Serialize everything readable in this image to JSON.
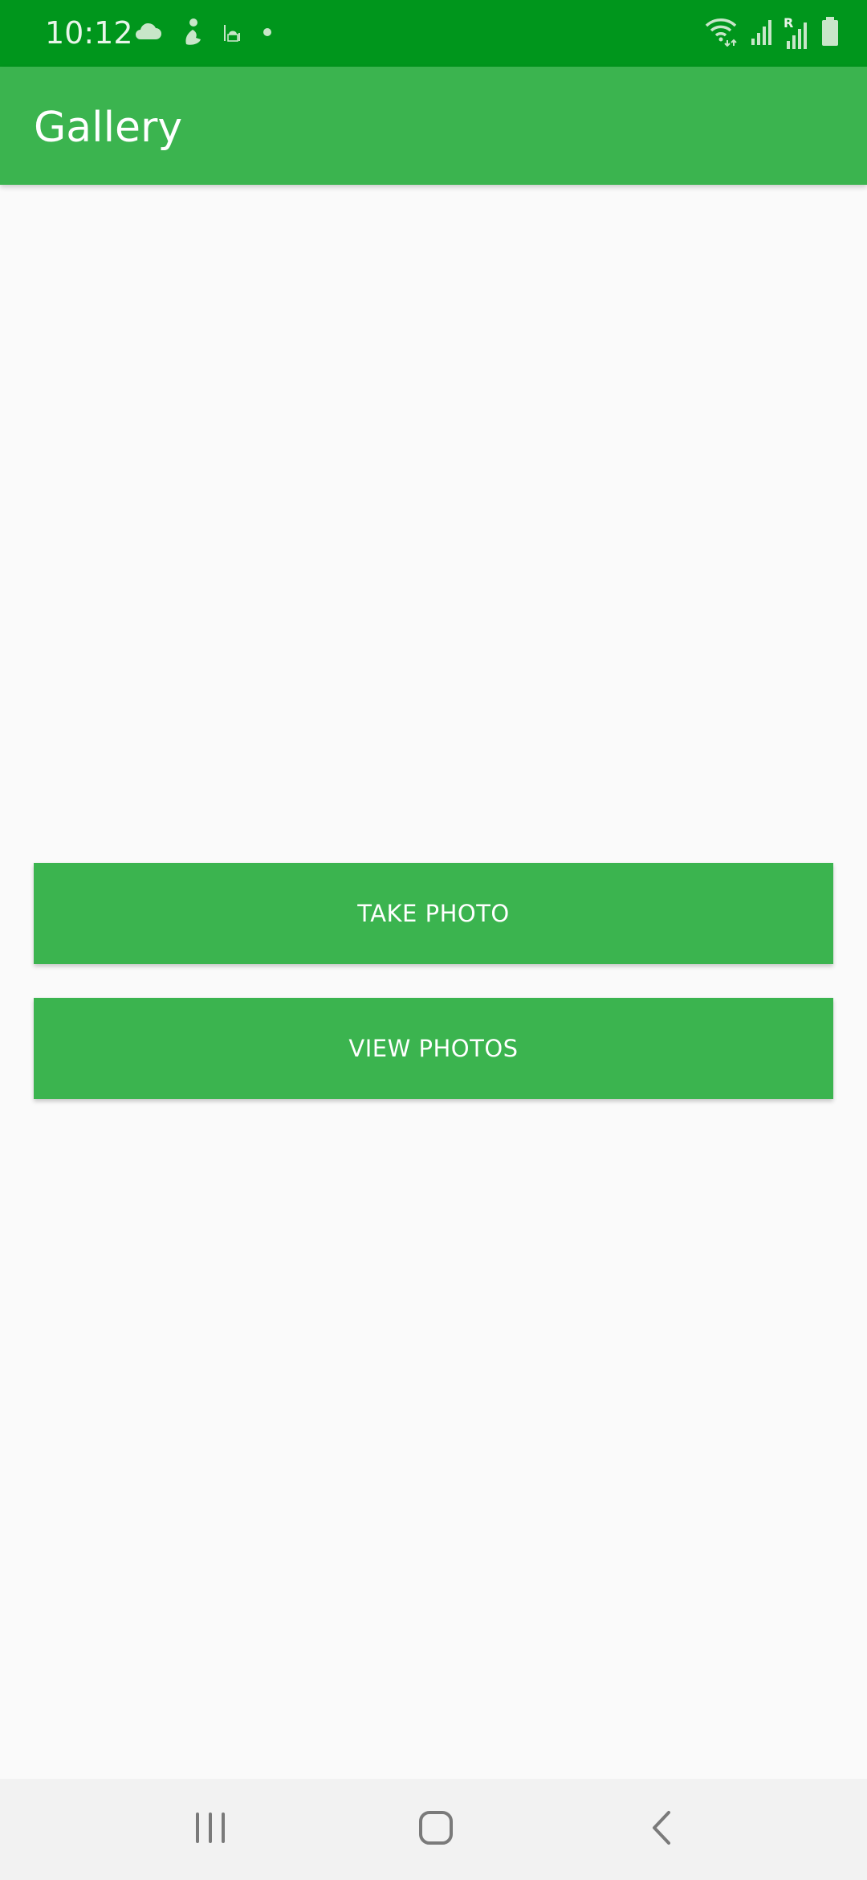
{
  "status_bar": {
    "time": "10:12",
    "icons_left": [
      "cloud-icon",
      "person-icon",
      "mosque-icon",
      "notification-dot-icon"
    ],
    "icons_right": [
      "wifi-icon",
      "signal-icon",
      "signal-roaming-icon",
      "battery-icon"
    ],
    "roaming_label": "R",
    "color": "#00961c"
  },
  "app_bar": {
    "title": "Gallery",
    "color": "#3bb44f"
  },
  "buttons": {
    "take_photo": "TAKE PHOTO",
    "view_photos": "VIEW PHOTOS"
  },
  "nav_bar": {
    "items": [
      "recent-apps-icon",
      "home-icon",
      "back-icon"
    ]
  }
}
